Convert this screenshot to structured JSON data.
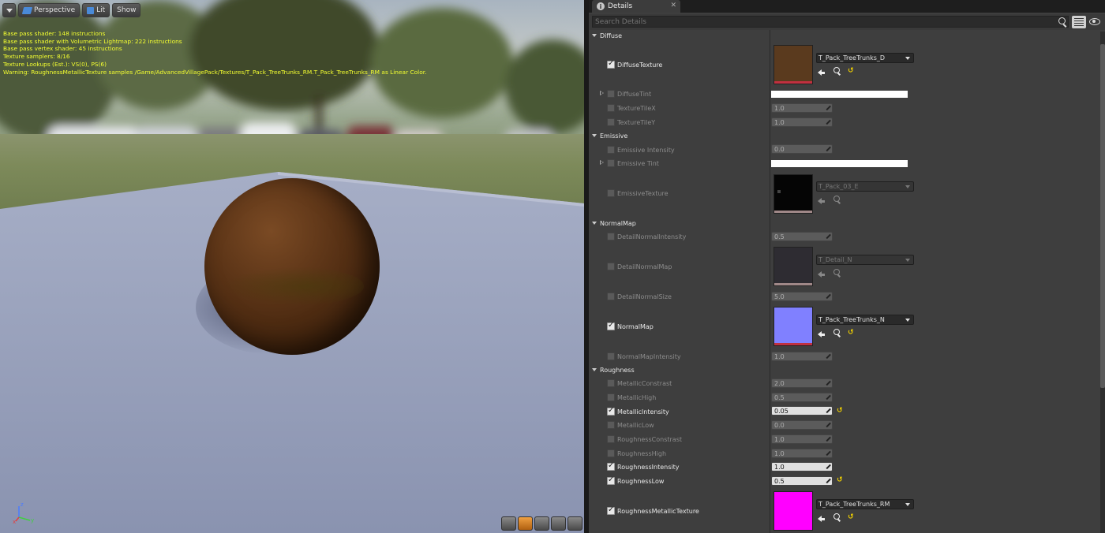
{
  "viewport": {
    "toolbar": {
      "perspective": "Perspective",
      "lit": "Lit",
      "show": "Show"
    },
    "stats": [
      "Base pass shader: 148 instructions",
      "Base pass shader with Volumetric Lightmap: 222 instructions",
      "Base pass vertex shader: 45 instructions",
      "Texture samplers: 8/16",
      "Texture Lookups (Est.): VS(0), PS(6)",
      "Warning: RoughnessMetallicTexture samples /Game/AdvancedVillagePack/Textures/T_Pack_TreeTrunks_RM.T_Pack_TreeTrunks_RM as Linear Color."
    ],
    "axis": {
      "x": "x",
      "y": "y",
      "z": "z"
    }
  },
  "details": {
    "tab_title": "Details",
    "search_placeholder": "Search Details",
    "categories": {
      "diffuse": "Diffuse",
      "emissive": "Emissive",
      "normalmap": "NormalMap",
      "roughness": "Roughness"
    },
    "props": {
      "diffuse_texture": {
        "label": "DiffuseTexture",
        "asset": "T_Pack_TreeTrunks_D"
      },
      "diffuse_tint": {
        "label": "DiffuseTint"
      },
      "texture_tile_x": {
        "label": "TextureTileX",
        "value": "1.0"
      },
      "texture_tile_y": {
        "label": "TextureTileY",
        "value": "1.0"
      },
      "emissive_intensity": {
        "label": "Emissive Intensity",
        "value": "0.0"
      },
      "emissive_tint": {
        "label": "Emissive Tint"
      },
      "emissive_texture": {
        "label": "EmissiveTexture",
        "asset": "T_Pack_03_E"
      },
      "detail_normal_intensity": {
        "label": "DetailNormalIntensity",
        "value": "0.5"
      },
      "detail_normal_map": {
        "label": "DetailNormalMap",
        "asset": "T_Detail_N"
      },
      "detail_normal_size": {
        "label": "DetailNormalSize",
        "value": "5.0"
      },
      "normal_map": {
        "label": "NormalMap",
        "asset": "T_Pack_TreeTrunks_N"
      },
      "normal_map_intensity": {
        "label": "NormalMapIntensity",
        "value": "1.0"
      },
      "metallic_constrast": {
        "label": "MetallicConstrast",
        "value": "2.0"
      },
      "metallic_high": {
        "label": "MetallicHigh",
        "value": "0.5"
      },
      "metallic_intensity": {
        "label": "MetallicIntensity",
        "value": "0.05"
      },
      "metallic_low": {
        "label": "MetallicLow",
        "value": "0.0"
      },
      "roughness_constrast": {
        "label": "RoughnessConstrast",
        "value": "1.0"
      },
      "roughness_high": {
        "label": "RoughnessHigh",
        "value": "1.0"
      },
      "roughness_intensity": {
        "label": "RoughnessIntensity",
        "value": "1.0"
      },
      "roughness_low": {
        "label": "RoughnessLow",
        "value": "0.5"
      },
      "roughness_metallic_texture": {
        "label": "RoughnessMetallicTexture",
        "asset": "T_Pack_TreeTrunks_RM"
      }
    },
    "colors": {
      "diffuse_thumb": "#5a3a1e",
      "emissive_thumb": "#050505",
      "detail_normal_thumb": "#2e2c32",
      "normal_thumb": "#8080ff",
      "rm_thumb": "#ff00ff",
      "reset_accent": "#f0d000"
    }
  }
}
